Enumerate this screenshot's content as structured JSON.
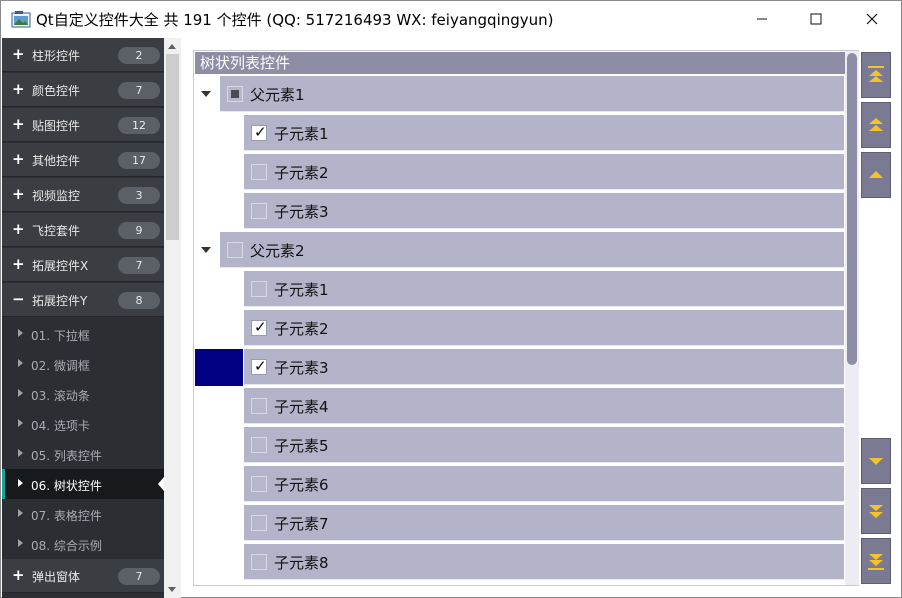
{
  "window": {
    "title": "Qt自定义控件大全 共 191 个控件 (QQ: 517216493 WX: feiyangqingyun)"
  },
  "titlebar_icons": {
    "minimize": "minimize-icon",
    "maximize": "maximize-icon",
    "close": "close-icon"
  },
  "nav": {
    "groups_top": [
      {
        "label": "柱形控件",
        "count": "2"
      },
      {
        "label": "颜色控件",
        "count": "7"
      },
      {
        "label": "贴图控件",
        "count": "12"
      },
      {
        "label": "其他控件",
        "count": "17"
      },
      {
        "label": "视频监控",
        "count": "3"
      },
      {
        "label": "飞控套件",
        "count": "9"
      },
      {
        "label": "拓展控件X",
        "count": "7"
      },
      {
        "label": "拓展控件Y",
        "count": "8"
      }
    ],
    "items": [
      {
        "label": "01. 下拉框"
      },
      {
        "label": "02. 微调框"
      },
      {
        "label": "03. 滚动条"
      },
      {
        "label": "04. 选项卡"
      },
      {
        "label": "05. 列表控件"
      },
      {
        "label": "06. 树状控件"
      },
      {
        "label": "07. 表格控件"
      },
      {
        "label": "08. 综合示例"
      }
    ],
    "active_item": "06. 树状控件",
    "groups_bottom": [
      {
        "label": "弹出窗体",
        "count": "7"
      }
    ]
  },
  "tree": {
    "header": "树状列表控件",
    "parents": [
      {
        "label": "父元素1",
        "state": "partial",
        "children": [
          {
            "label": "子元素1",
            "checked": true
          },
          {
            "label": "子元素2",
            "checked": false
          },
          {
            "label": "子元素3",
            "checked": false
          }
        ]
      },
      {
        "label": "父元素2",
        "state": "unchecked",
        "children": [
          {
            "label": "子元素1",
            "checked": false
          },
          {
            "label": "子元素2",
            "checked": true
          },
          {
            "label": "子元素3",
            "checked": true
          },
          {
            "label": "子元素4",
            "checked": false
          },
          {
            "label": "子元素5",
            "checked": false
          },
          {
            "label": "子元素6",
            "checked": false
          },
          {
            "label": "子元素7",
            "checked": false
          },
          {
            "label": "子元素8",
            "checked": false
          }
        ]
      }
    ]
  },
  "side_buttons": [
    "move-top-icon",
    "move-page-up-icon",
    "move-up-icon",
    "move-down-icon",
    "move-page-down-icon",
    "move-bottom-icon"
  ],
  "colors": {
    "row": "#b3b3c9",
    "header": "#8d8da6",
    "selection": "#000080",
    "nav_bg": "#2b2e33",
    "accent": "#1aa39a",
    "arrow": "#f3c32c"
  }
}
